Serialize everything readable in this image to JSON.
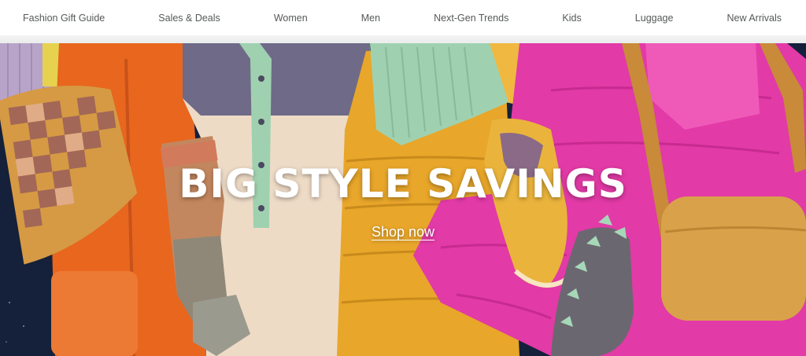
{
  "nav": {
    "items": [
      {
        "label": "Fashion Gift Guide"
      },
      {
        "label": "Sales & Deals"
      },
      {
        "label": "Women"
      },
      {
        "label": "Men"
      },
      {
        "label": "Next-Gen Trends"
      },
      {
        "label": "Kids"
      },
      {
        "label": "Luggage"
      },
      {
        "label": "New Arrivals"
      }
    ]
  },
  "hero": {
    "title": "BIG STYLE SAVINGS",
    "cta_label": "Shop now"
  },
  "colors": {
    "background_night": "#15203a",
    "orange_pants": "#e8661e",
    "purple_top": "#6f6a87",
    "cream_top": "#eedbc6",
    "mustard_vest": "#e8a62a",
    "pink_jacket": "#e23aa6",
    "mint_beanie": "#9fd1b0",
    "tan_bag": "#d9a24a",
    "nav_text": "#565959"
  }
}
